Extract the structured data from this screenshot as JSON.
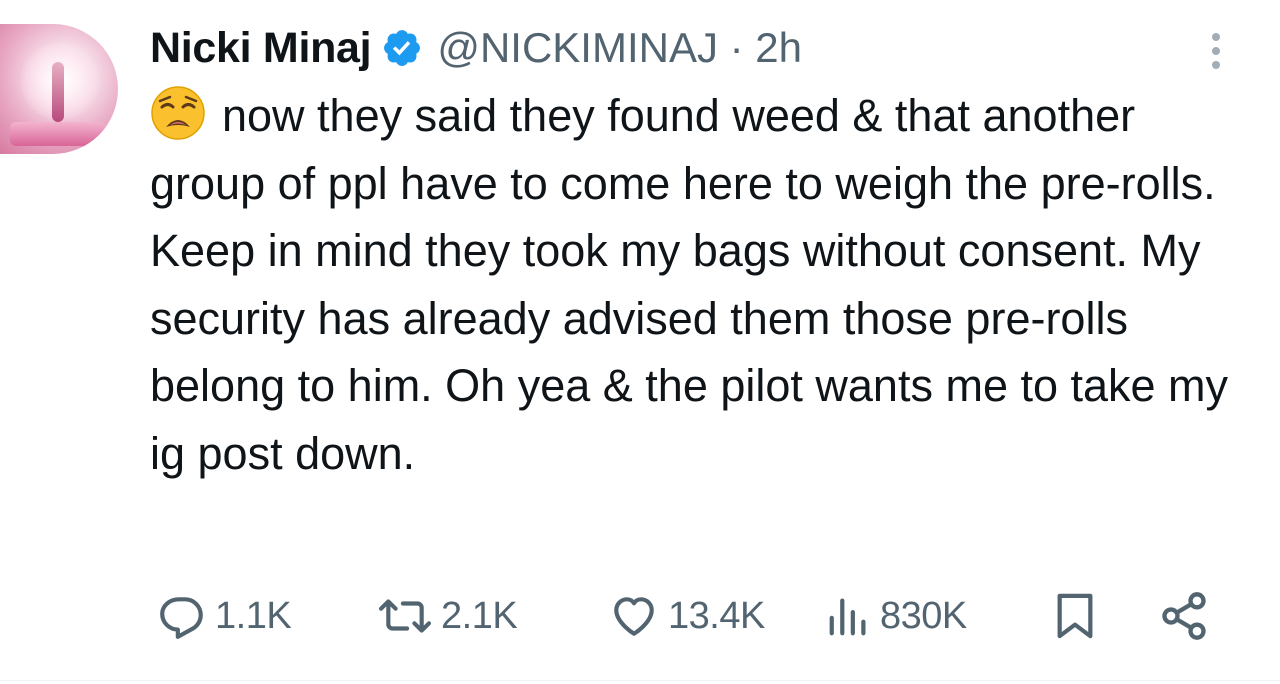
{
  "tweet": {
    "author_name": "Nicki Minaj",
    "handle_time": "@NICKIMINAJ · 2h",
    "text": "now they said they found weed & that another group of ppl have to come here to weigh the pre-rolls. Keep in mind they took my bags without consent. My security has already advised them those pre-rolls belong to him. Oh yea & the pilot wants me to take my ig post down.",
    "emoji_icon": "weary-face-icon"
  },
  "actions": {
    "replies": "1.1K",
    "reposts": "2.1K",
    "likes": "13.4K",
    "views": "830K"
  },
  "colors": {
    "text": "#0f1419",
    "secondary": "#536471",
    "verified": "#1d9bf0"
  }
}
